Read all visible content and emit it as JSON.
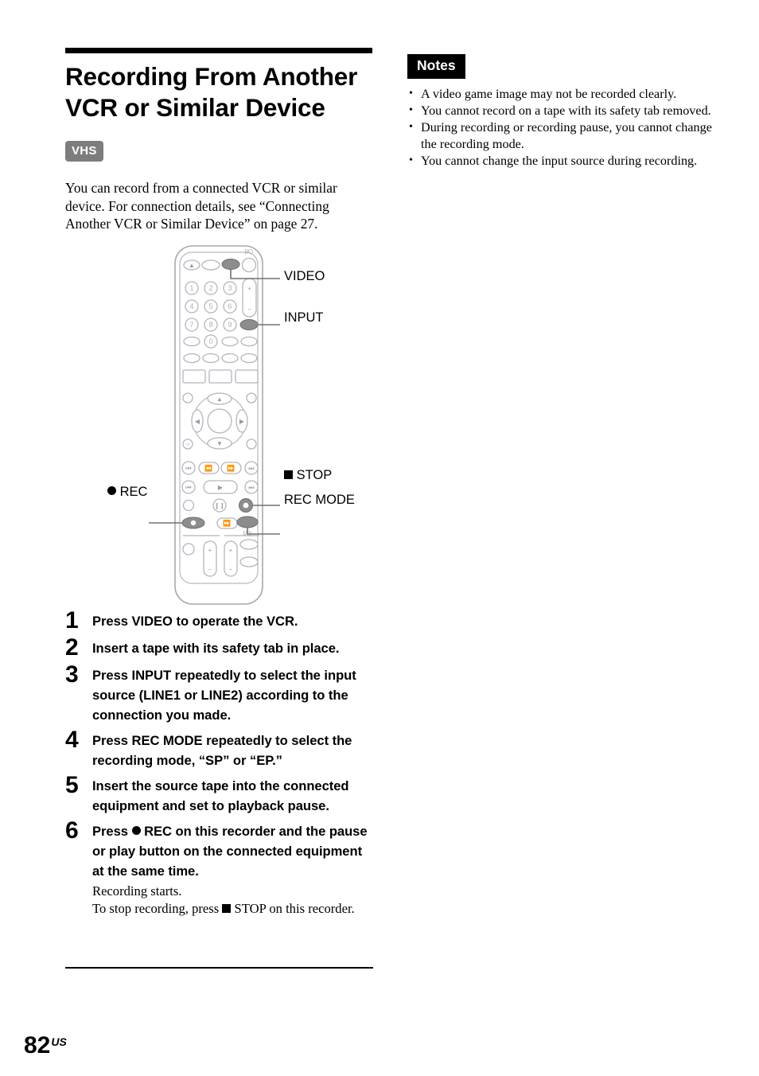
{
  "document": {
    "title": "Recording From Another\nVCR or Similar Device",
    "badge": "VHS",
    "intro": "You can record from a connected VCR or similar device. For connection details, see “Connecting Another VCR or Similar Device” on page 27.",
    "page_number": "82",
    "page_suffix": "US"
  },
  "notes": {
    "heading": "Notes",
    "items": [
      "A video game image may not be recorded clearly.",
      "You cannot record on a tape with its safety tab removed.",
      "During recording or recording pause, you cannot change the recording mode.",
      "You cannot change the input source during recording."
    ]
  },
  "steps": [
    {
      "number": "1",
      "text": "Press VIDEO to operate the VCR.",
      "sub": ""
    },
    {
      "number": "2",
      "text": "Insert a tape with its safety tab in place.",
      "sub": ""
    },
    {
      "number": "3",
      "text": "Press INPUT repeatedly to select the input source (LINE1 or LINE2) according to the connection you made.",
      "sub": ""
    },
    {
      "number": "4",
      "text": "Press REC MODE repeatedly to select the recording mode, “SP” or “EP.”",
      "sub": ""
    },
    {
      "number": "5",
      "text": "Insert the source tape into the connected equipment and set to playback pause.",
      "sub": ""
    },
    {
      "number": "6",
      "text_before_glyph": "Press ",
      "text_after_glyph": " REC on this recorder and the pause or play button on the connected equipment at the same time.",
      "sub_line1": "Recording starts.",
      "sub_line2_before": "To stop recording, press ",
      "sub_line2_after": " STOP on this recorder."
    }
  ],
  "remote_diagram": {
    "callouts": [
      {
        "id": "video",
        "label": "VIDEO"
      },
      {
        "id": "input",
        "label": "INPUT"
      },
      {
        "id": "stop",
        "label": "STOP",
        "glyph": "filled-square"
      },
      {
        "id": "rec_mode",
        "label": "REC MODE"
      },
      {
        "id": "rec",
        "label": "REC",
        "glyph": "filled-circle"
      }
    ],
    "keypad_digits": [
      "1",
      "2",
      "3",
      "4",
      "5",
      "6",
      "7",
      "8",
      "9",
      "0"
    ],
    "power_label": "I/⏻",
    "volume_plus": "+",
    "volume_minus": "−"
  },
  "colors": {
    "ink": "#000000",
    "badge_gray": "#7d7d7d",
    "remote_outline": "#a8a8b0",
    "remote_button": "#c9c9d0",
    "highlight_button": "#8a8a8a",
    "callout_line": "#6a6a6a"
  }
}
